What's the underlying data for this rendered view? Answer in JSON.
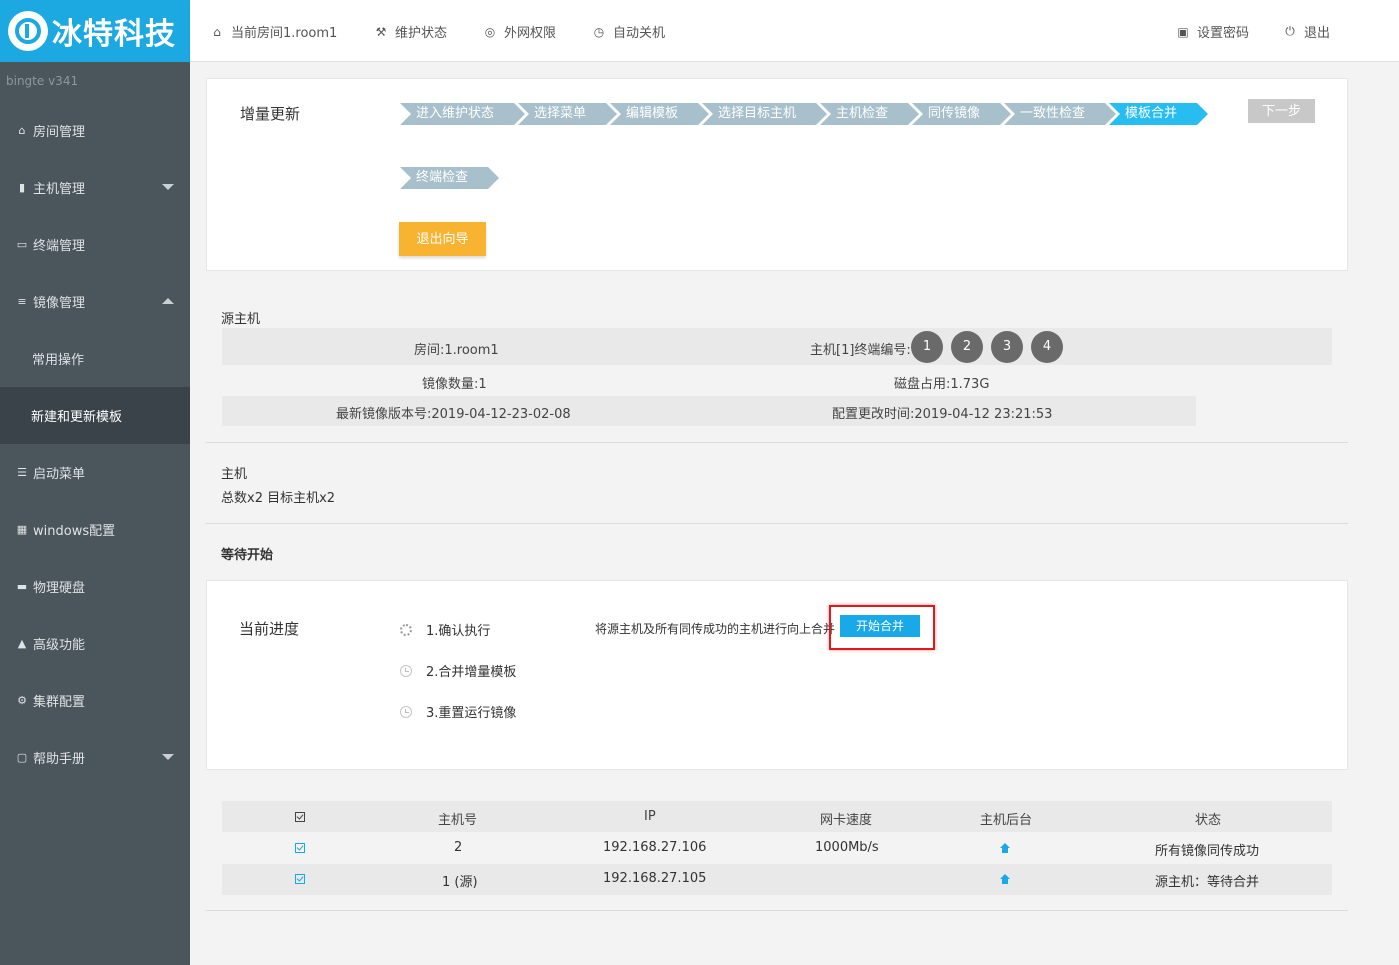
{
  "brand": {
    "name": "冰特科技",
    "version": "bingte  v341",
    "color": "#1ca8e0"
  },
  "sidebar": {
    "items": [
      {
        "label": "房间管理",
        "icon": "home-icon"
      },
      {
        "label": "主机管理",
        "icon": "server-icon",
        "caret": "down"
      },
      {
        "label": "终端管理",
        "icon": "monitor-icon"
      },
      {
        "label": "镜像管理",
        "icon": "database-icon",
        "caret": "up"
      },
      {
        "label": "常用操作",
        "sub": true
      },
      {
        "label": "新建和更新模板",
        "sub": true,
        "active": true
      },
      {
        "label": "启动菜单",
        "icon": "list-icon"
      },
      {
        "label": "windows配置",
        "icon": "windows-icon"
      },
      {
        "label": "物理硬盘",
        "icon": "hdd-icon"
      },
      {
        "label": "高级功能",
        "icon": "warning-icon"
      },
      {
        "label": "集群配置",
        "icon": "gear-icon"
      },
      {
        "label": "帮助手册",
        "icon": "book-icon",
        "caret": "down"
      }
    ]
  },
  "topbar": {
    "room": "当前房间1.room1",
    "maintenance": "维护状态",
    "internet": "外网权限",
    "shutdown": "自动关机",
    "password": "设置密码",
    "logout": "退出"
  },
  "wizard": {
    "title": "增量更新",
    "steps": [
      "进入维护状态",
      "选择菜单",
      "编辑模板",
      "选择目标主机",
      "主机检查",
      "同传镜像",
      "一致性检查",
      "模板合并",
      "终端检查"
    ],
    "active_step": "模板合并",
    "next_label": "下一步",
    "exit_label": "退出向导"
  },
  "source_host": {
    "heading": "源主机",
    "room": "房间:1.room1",
    "terminal_label": "主机[1]终端编号:",
    "terminals": [
      "1",
      "2",
      "3",
      "4"
    ],
    "image_count": "镜像数量:1",
    "disk_usage": "磁盘占用:1.73G",
    "latest_version": "最新镜像版本号:2019-04-12-23-02-08",
    "config_time": "配置更改时间:2019-04-12 23:21:53"
  },
  "hosts_summary": {
    "heading": "主机",
    "detail": "总数x2 目标主机x2"
  },
  "waiting": "等待开始",
  "progress": {
    "title": "当前进度",
    "steps": [
      "1.确认执行",
      "2.合并增量模板",
      "3.重置运行镜像"
    ],
    "merge_desc": "将源主机及所有同传成功的主机进行向上合并",
    "merge_button": "开始合并"
  },
  "table": {
    "headers": [
      "主机号",
      "IP",
      "网卡速度",
      "主机后台",
      "状态"
    ],
    "rows": [
      {
        "host": "2",
        "ip": "192.168.27.106",
        "speed": "1000Mb/s",
        "status": "所有镜像同传成功"
      },
      {
        "host": "1 (源)",
        "ip": "192.168.27.105",
        "speed": "",
        "status": "源主机：等待合并"
      }
    ]
  },
  "colors": {
    "accent": "#1aa9e8",
    "warning": "#f8b331",
    "highlight": "#e01a1a",
    "sidebar": "#4a555c"
  }
}
